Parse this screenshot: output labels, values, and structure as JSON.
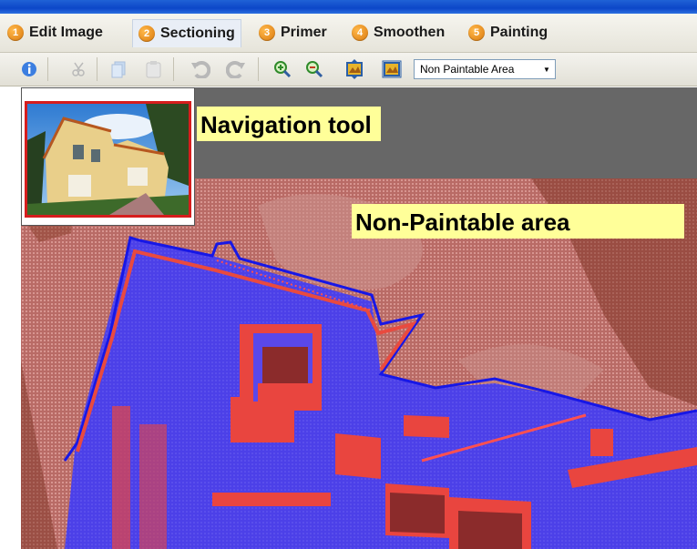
{
  "tabs": [
    {
      "num": "1",
      "label": "Edit Image"
    },
    {
      "num": "2",
      "label": "Sectioning"
    },
    {
      "num": "3",
      "label": "Primer"
    },
    {
      "num": "4",
      "label": "Smoothen"
    },
    {
      "num": "5",
      "label": "Painting"
    }
  ],
  "toolbar": {
    "icons": [
      "info-icon",
      "cut-icon",
      "copy-icon",
      "paste-icon",
      "undo-icon",
      "redo-icon",
      "zoom-in-icon",
      "zoom-out-icon",
      "fit-height-icon",
      "fit-width-icon"
    ],
    "select_value": "Non Paintable Area"
  },
  "annotations": {
    "navigation": "Navigation tool",
    "non_paintable": "Non-Paintable area"
  },
  "colors": {
    "title_bar": "#0c46c8",
    "paintable_overlay": "#4a3cf0",
    "non_paintable_overlay": "#e2423c",
    "callout_bg": "#ffff99",
    "tab_badge": "#e88a1a"
  }
}
